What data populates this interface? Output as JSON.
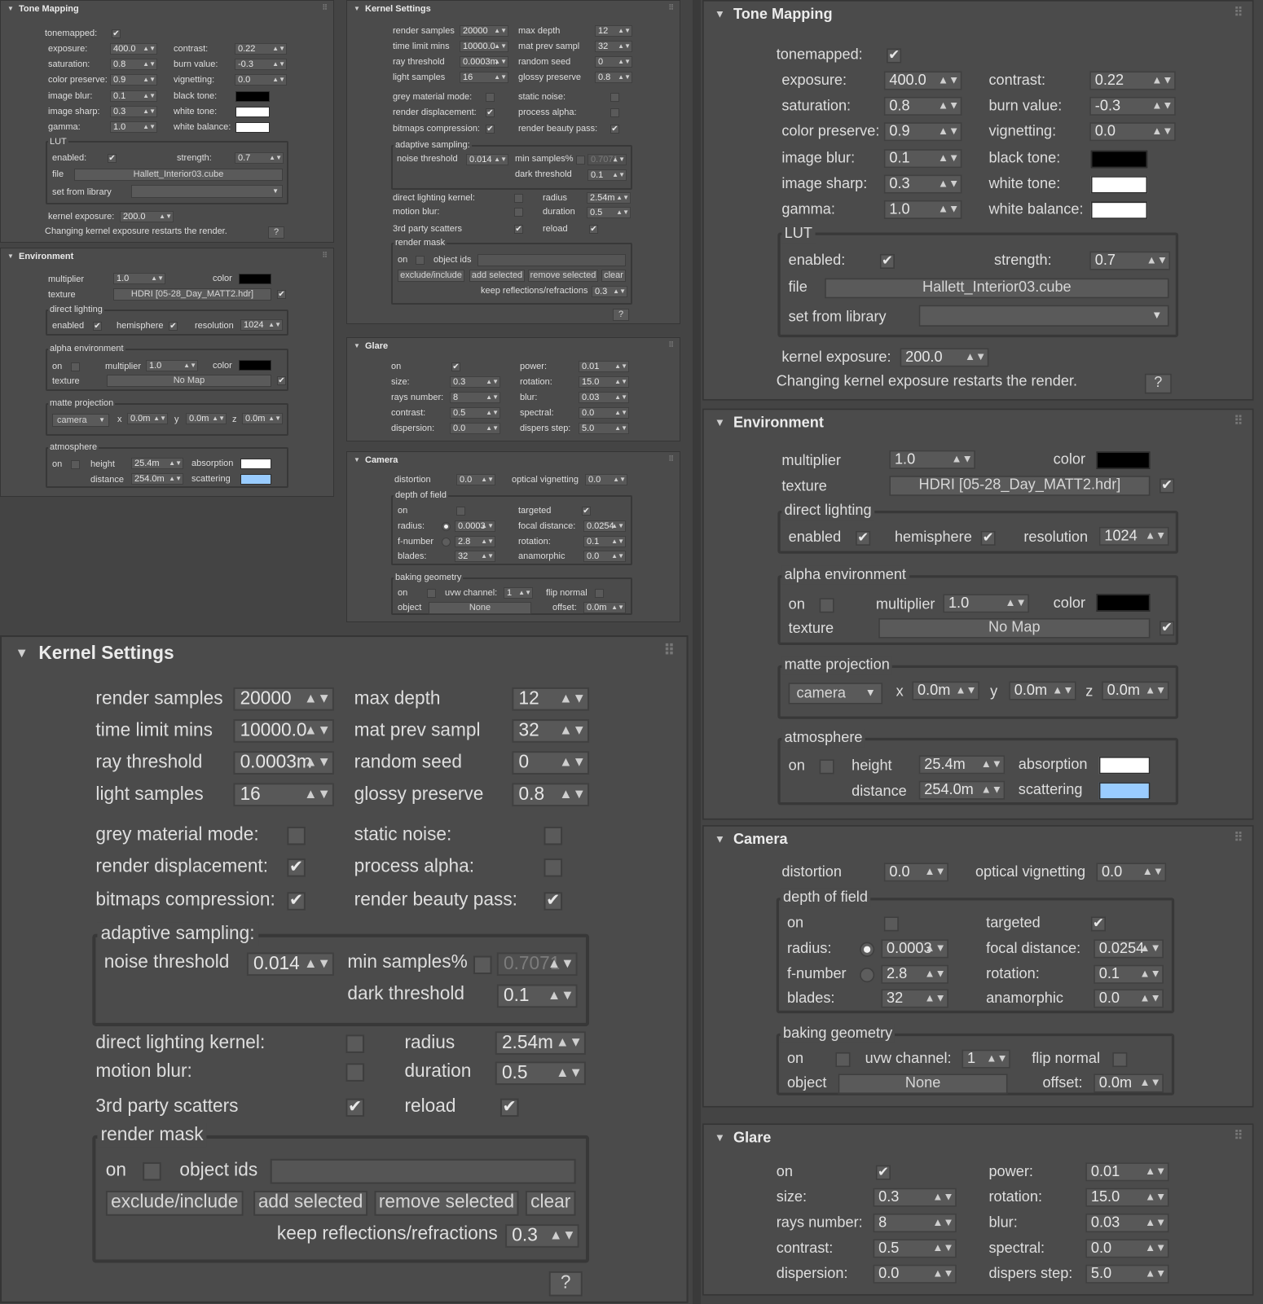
{
  "icons": {
    "collapse": "▼",
    "grip": "⠿",
    "spinner": "▲▼",
    "check": "✔",
    "dropdown": "▼"
  },
  "colors": {
    "black_tone": "#000000",
    "white_tone": "#ffffff",
    "white_balance": "#ffffff",
    "env_color": "#000000",
    "alpha_color": "#000000",
    "absorption": "#ffffff",
    "scattering": "#99ccff"
  },
  "tone": {
    "title": "Tone Mapping",
    "tonemapped": "tonemapped:",
    "exposure": "exposure:",
    "exposure_v": "400.0",
    "contrast": "contrast:",
    "contrast_v": "0.22",
    "saturation": "saturation:",
    "saturation_v": "0.8",
    "burn": "burn value:",
    "burn_v": "-0.3",
    "colorpres": "color preserve:",
    "colorpres_v": "0.9",
    "vignetting": "vignetting:",
    "vignetting_v": "0.0",
    "blur": "image blur:",
    "blur_v": "0.1",
    "black": "black tone:",
    "sharp": "image sharp:",
    "sharp_v": "0.3",
    "white": "white tone:",
    "gamma": "gamma:",
    "gamma_v": "1.0",
    "wb": "white balance:",
    "lut": "LUT",
    "enabled": "enabled:",
    "strength": "strength:",
    "strength_v": "0.7",
    "file": "file",
    "file_v": "Hallett_Interior03.cube",
    "setlib": "set from library",
    "kexp": "kernel exposure:",
    "kexp_v": "200.0",
    "note": "Changing kernel exposure restarts the render.",
    "help": "?"
  },
  "env": {
    "title": "Environment",
    "multiplier": "multiplier",
    "multiplier_v": "1.0",
    "color": "color",
    "texture": "texture",
    "texture_v": "HDRI  [05-28_Day_MATT2.hdr]",
    "dl": "direct lighting",
    "enabled": "enabled",
    "hemisphere": "hemisphere",
    "resolution": "resolution",
    "resolution_v": "1024",
    "ae": "alpha environment",
    "on": "on",
    "ae_mult": "multiplier",
    "ae_mult_v": "1.0",
    "ae_color": "color",
    "ae_texture": "texture",
    "ae_texture_v": "No Map",
    "mp": "matte projection",
    "camera": "camera",
    "x": "x",
    "x_v": "0.0m",
    "y": "y",
    "y_v": "0.0m",
    "z": "z",
    "z_v": "0.0m",
    "atm": "atmosphere",
    "atm_on": "on",
    "height": "height",
    "height_v": "25.4m",
    "absorption": "absorption",
    "distance": "distance",
    "distance_v": "254.0m",
    "scattering": "scattering"
  },
  "kernel": {
    "title": "Kernel Settings",
    "rs": "render samples",
    "rs_v": "20000",
    "md": "max depth",
    "md_v": "12",
    "tl": "time limit mins",
    "tl_v": "10000.0",
    "mps": "mat prev sampl",
    "mps_v": "32",
    "rt": "ray threshold",
    "rt_v": "0.0003m",
    "seed": "random seed",
    "seed_v": "0",
    "ls": "light samples",
    "ls_v": "16",
    "gp": "glossy preserve",
    "gp_v": "0.8",
    "gmm": "grey material mode:",
    "sn": "static noise:",
    "rd": "render displacement:",
    "pa": "process alpha:",
    "bc": "bitmaps compression:",
    "rbp": "render beauty pass:",
    "as": "adaptive sampling:",
    "nt": "noise threshold",
    "nt_v": "0.014",
    "ms": "min samples%",
    "ms_v": "0.7071",
    "dt": "dark threshold",
    "dt_v": "0.1",
    "dlk": "direct lighting kernel:",
    "radius": "radius",
    "radius_v": "2.54m",
    "mb": "motion blur:",
    "duration": "duration",
    "duration_v": "0.5",
    "tps": "3rd party scatters",
    "reload": "reload",
    "rm": "render mask",
    "on": "on",
    "oid": "object ids",
    "exc": "exclude/include",
    "adds": "add selected",
    "rems": "remove selected",
    "clear": "clear",
    "krr": "keep reflections/refractions",
    "krr_v": "0.3",
    "help": "?"
  },
  "glare": {
    "title": "Glare",
    "on": "on",
    "power": "power:",
    "power_v": "0.01",
    "size": "size:",
    "size_v": "0.3",
    "rotation": "rotation:",
    "rotation_v": "15.0",
    "rays": "rays number:",
    "rays_v": "8",
    "blur": "blur:",
    "blur_v": "0.03",
    "contrast": "contrast:",
    "contrast_v": "0.5",
    "spectral": "spectral:",
    "spectral_v": "0.0",
    "dispersion": "dispersion:",
    "dispersion_v": "0.0",
    "dstep": "dispers step:",
    "dstep_v": "5.0"
  },
  "camera": {
    "title": "Camera",
    "distortion": "distortion",
    "distortion_v": "0.0",
    "ov": "optical vignetting",
    "ov_v": "0.0",
    "dof": "depth of field",
    "on": "on",
    "targeted": "targeted",
    "radius": "radius:",
    "radius_v": "0.0003",
    "fd": "focal distance:",
    "fd_v": "0.0254",
    "fnum": "f-number",
    "fnum_v": "2.8",
    "rot": "rotation:",
    "rot_v": "0.1",
    "blades": "blades:",
    "blades_v": "32",
    "ana": "anamorphic",
    "ana_v": "0.0",
    "bg": "baking geometry",
    "bg_on": "on",
    "uvw": "uvw channel:",
    "uvw_v": "1",
    "flip": "flip normal",
    "object": "object",
    "object_v": "None",
    "offset": "offset:",
    "offset_v": "0.0m"
  }
}
